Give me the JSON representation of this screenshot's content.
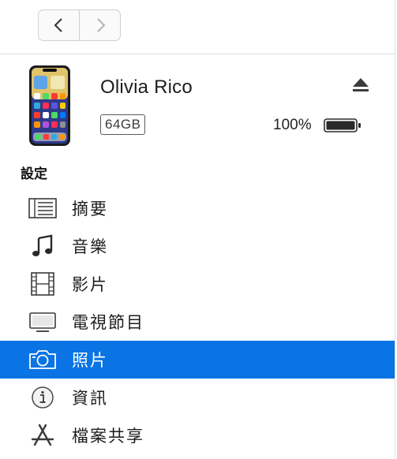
{
  "device": {
    "name": "Olivia Rico",
    "capacity": "64GB",
    "battery": "100%",
    "battery_level": 1.0
  },
  "settings": {
    "heading": "設定",
    "items": [
      {
        "label": "摘要",
        "icon": "summary-icon",
        "selected": false
      },
      {
        "label": "音樂",
        "icon": "music-note-icon",
        "selected": false
      },
      {
        "label": "影片",
        "icon": "film-icon",
        "selected": false
      },
      {
        "label": "電視節目",
        "icon": "tv-icon",
        "selected": false
      },
      {
        "label": "照片",
        "icon": "camera-icon",
        "selected": true
      },
      {
        "label": "資訊",
        "icon": "info-icon",
        "selected": false
      },
      {
        "label": "檔案共享",
        "icon": "app-store-icon",
        "selected": false
      }
    ]
  },
  "colors": {
    "selection": "#0a74e4",
    "icon_gray": "#3a3a3a"
  }
}
